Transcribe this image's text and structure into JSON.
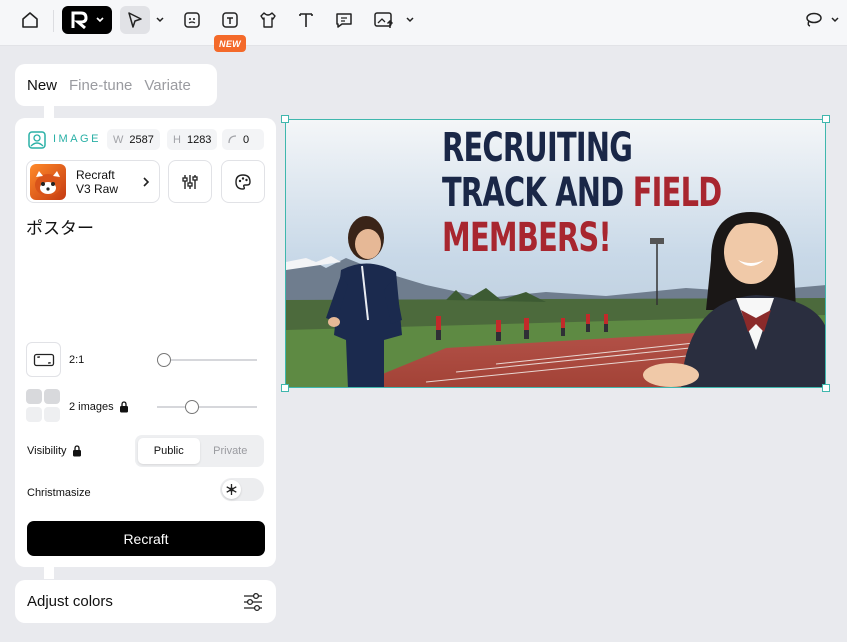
{
  "toolbar": {
    "home": "home-icon",
    "new_badge": "NEW",
    "tools": [
      "cursor-icon",
      "face-icon",
      "tshirt-stamp-icon",
      "tshirt-icon",
      "text-icon",
      "chat-icon",
      "image-upload-icon"
    ]
  },
  "panel": {
    "tabs": [
      {
        "label": "New",
        "active": true
      },
      {
        "label": "Fine-tune",
        "active": false
      },
      {
        "label": "Variate",
        "active": false
      }
    ],
    "image_label": "IMAGE",
    "width_label": "W",
    "width_value": "2587",
    "height_label": "H",
    "height_value": "1283",
    "rotation_value": "0",
    "model_name_line1": "Recraft",
    "model_name_line2": "V3 Raw",
    "prompt": "ポスター",
    "aspect_ratio": "2:1",
    "images_count": "2 images",
    "visibility_label": "Visibility",
    "visibility_options": [
      "Public",
      "Private"
    ],
    "visibility_selected": "Public",
    "christmasize_label": "Christmasize",
    "generate_label": "Recraft",
    "adjust_colors_label": "Adjust colors"
  },
  "canvas": {
    "poster_line1": "RECRUITING",
    "poster_line2a": "TRACK AND ",
    "poster_line2b": "FIELD",
    "poster_line3": "MEMBERS!"
  },
  "colors": {
    "accent": "#3fb7ad",
    "badge": "#f46a2a",
    "poster_navy": "#1a2747",
    "poster_red": "#a8262f"
  }
}
